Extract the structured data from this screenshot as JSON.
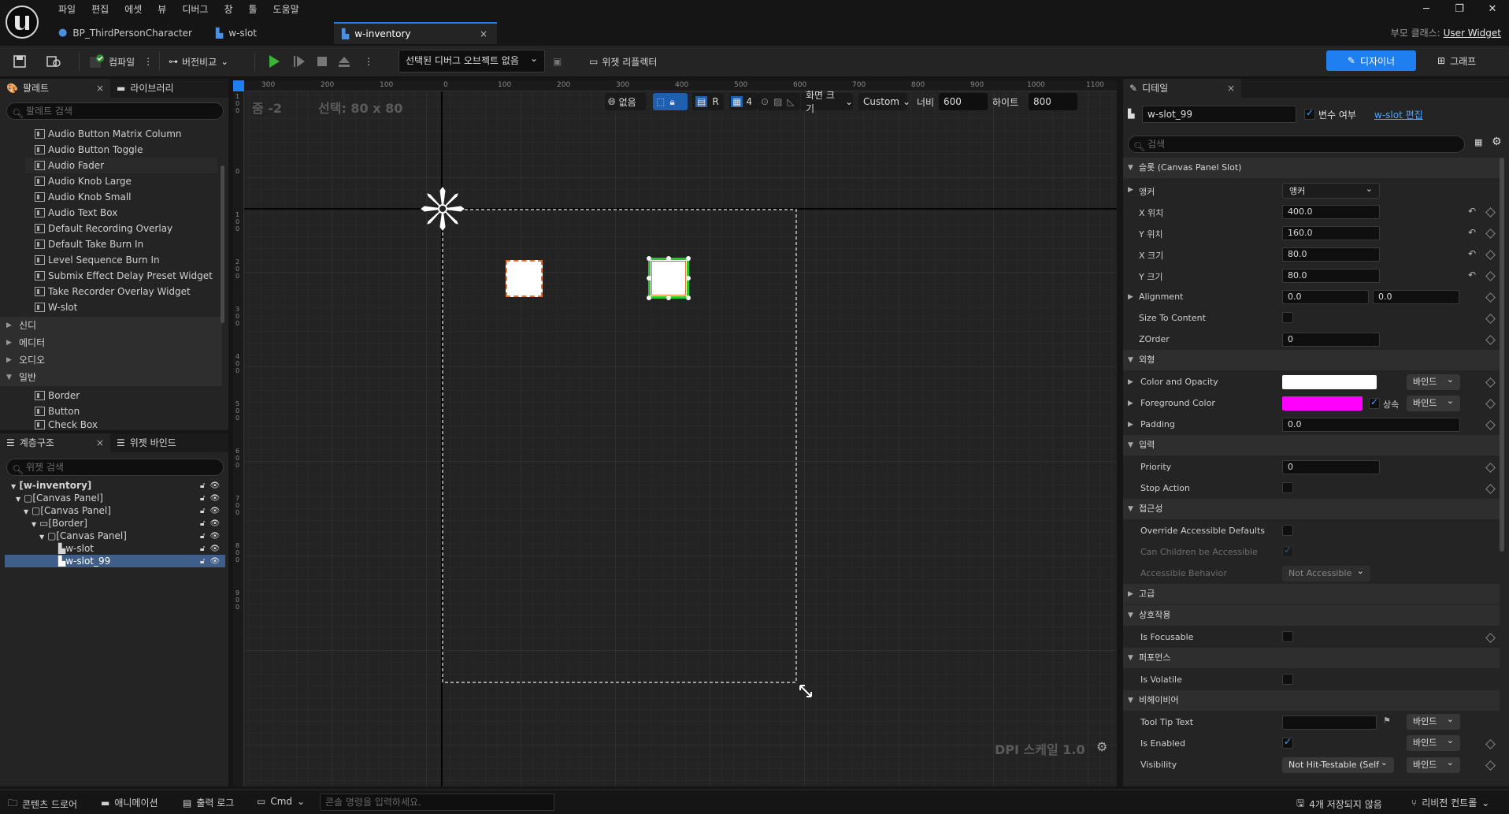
{
  "menu": [
    "파일",
    "편집",
    "에셋",
    "뷰",
    "디버그",
    "창",
    "툴",
    "도움말"
  ],
  "tabs": [
    {
      "label": "BP_ThirdPersonCharacter"
    },
    {
      "label": "w-slot"
    },
    {
      "label": "w-inventory",
      "close": "×"
    }
  ],
  "window_controls": {
    "minimize": "─",
    "maximize": "❐",
    "close": "✕"
  },
  "parent_class": {
    "label": "부모 클래스:",
    "value": "User Widget"
  },
  "toolbar": {
    "compile": "컴파일",
    "diff": "버전비교",
    "debug_object": "선택된 디버그 오브젝트 없음",
    "widget_reflector": "위젯 리플렉터",
    "designer": "디자이너",
    "graph": "그래프"
  },
  "palette": {
    "tab": "팔레트",
    "library_tab": "라이브러리",
    "search_placeholder": "팔레트 검색",
    "items": [
      "Audio Button Matrix Column",
      "Audio Button Toggle",
      "Audio Fader",
      "Audio Knob Large",
      "Audio Knob Small",
      "Audio Text Box",
      "Default Recording Overlay",
      "Default Take Burn In",
      "Level Sequence Burn In",
      "Submix Effect Delay Preset Widget",
      "Take Recorder Overlay Widget",
      "W-slot"
    ],
    "categories": [
      "신디",
      "에디터",
      "오디오",
      "일반"
    ],
    "general_items": [
      "Border",
      "Button",
      "Check Box"
    ]
  },
  "hierarchy": {
    "tab": "계층구조",
    "binding_tab": "위젯 바인드",
    "search_placeholder": "위젯 검색",
    "nodes": [
      "[w-inventory]",
      "[Canvas Panel]",
      "[Canvas Panel]",
      "[Border]",
      "[Canvas Panel]",
      "w-slot",
      "w-slot_99"
    ]
  },
  "viewport": {
    "zoom": "줌 -2",
    "selection": "선택: 80 x 80",
    "none_label": "없음",
    "r_label": "R",
    "grid_value": "4",
    "screen_size": "화면 크기",
    "preset": "Custom",
    "width_label": "너비",
    "width_value": "600",
    "height_label": "하이트",
    "height_value": "800",
    "dpi": "DPI 스케일 1.0",
    "ruler_top": [
      "300",
      "200",
      "100",
      "0",
      "100",
      "200",
      "300",
      "400",
      "500",
      "600",
      "700",
      "800",
      "900",
      "1000",
      "1100"
    ],
    "ruler_left": [
      "100",
      "0",
      "100",
      "200",
      "300",
      "400",
      "500",
      "600",
      "700",
      "800",
      "900"
    ]
  },
  "details": {
    "tab": "디테일",
    "widget_name": "w-slot_99",
    "is_variable_label": "변수 여부",
    "edit_link": "w-slot 편집",
    "search_placeholder": "검색",
    "sections": {
      "slot": "슬롯 (Canvas Panel Slot)",
      "appearance": "외형",
      "input": "입력",
      "accessibility": "접근성",
      "advanced": "고급",
      "interaction": "상호작용",
      "performance": "퍼포먼스",
      "behavior": "비헤이비어"
    },
    "anchor_label": "앵커",
    "anchor_value": "앵커",
    "x_pos_label": "X 위치",
    "x_pos": "400.0",
    "y_pos_label": "Y 위치",
    "y_pos": "160.0",
    "x_size_label": "X 크기",
    "x_size": "80.0",
    "y_size_label": "Y 크기",
    "y_size": "80.0",
    "alignment_label": "Alignment",
    "alignment_x": "0.0",
    "alignment_y": "0.0",
    "size_to_content": "Size To Content",
    "zorder_label": "ZOrder",
    "zorder": "0",
    "color_opacity": "Color and Opacity",
    "foreground_color": "Foreground Color",
    "inherit": "상속",
    "bind": "바인드",
    "padding_label": "Padding",
    "padding": "0.0",
    "priority_label": "Priority",
    "priority": "0",
    "stop_action": "Stop Action",
    "override_accessible": "Override Accessible Defaults",
    "children_accessible": "Can Children be Accessible",
    "accessible_behavior": "Accessible Behavior",
    "accessible_behavior_value": "Not Accessible",
    "is_focusable": "Is Focusable",
    "is_volatile": "Is Volatile",
    "tooltip": "Tool Tip Text",
    "is_enabled": "Is Enabled",
    "visibility_label": "Visibility",
    "visibility_value": "Not Hit-Testable (Self",
    "colors": {
      "white": "#ffffff",
      "magenta": "#ff00ff"
    }
  },
  "status": {
    "content_drawer": "콘텐츠 드로어",
    "animation": "애니메이션",
    "output_log": "출력 로그",
    "cmd": "Cmd",
    "cmd_placeholder": "콘솔 명령을 입력하세요.",
    "unsaved": "4개 저장되지 않음",
    "revision": "리비전 컨트롤"
  }
}
